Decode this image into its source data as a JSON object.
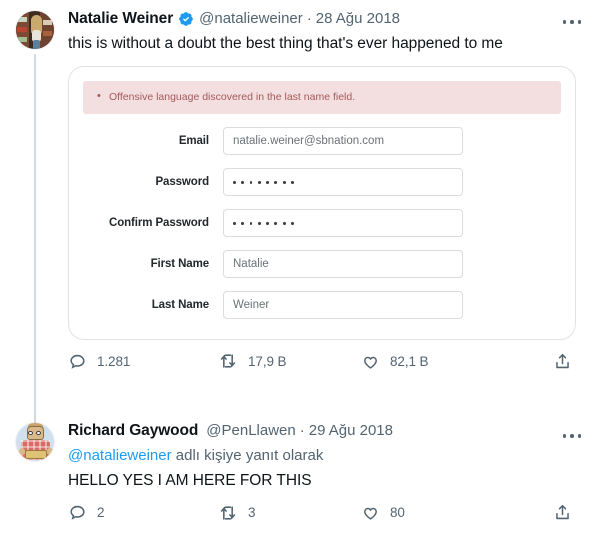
{
  "thread": {
    "tweets": [
      {
        "author_name": "Natalie Weiner",
        "verified": true,
        "handle": "@natalieweiner",
        "separator": "·",
        "date": "28 Ağu 2018",
        "text": "this is without a doubt the best thing that's ever happened to me",
        "avatar_kind": "photo-avatar",
        "more_label": "More",
        "actions": {
          "reply_count": "1.281",
          "retweet_count": "17,9 B",
          "like_count": "82,1 B",
          "share_label": ""
        }
      },
      {
        "author_name": "Richard Gaywood",
        "verified": false,
        "handle": "@PenLlawen",
        "separator": "·",
        "date": "29 Ağu 2018",
        "reply_context_mention": "@natalieweiner",
        "reply_context_suffix": " adlı kişiye yanıt olarak",
        "text": "HELLO YES I AM HERE FOR THIS",
        "avatar_kind": "cartoon-avatar",
        "more_label": "More",
        "actions": {
          "reply_count": "2",
          "retweet_count": "3",
          "like_count": "80",
          "share_label": ""
        }
      }
    ]
  },
  "embedded_form": {
    "alert": {
      "message": "Offensive language discovered in the last name field.",
      "bg_color": "#f3dfdf",
      "text_color": "#a4595b"
    },
    "fields": [
      {
        "label": "Email",
        "value": "natalie.weiner@sbnation.com",
        "type": "text"
      },
      {
        "label": "Password",
        "value": "",
        "type": "password",
        "dot_count": 8
      },
      {
        "label": "Confirm Password",
        "value": "",
        "type": "password",
        "dot_count": 8
      },
      {
        "label": "First Name",
        "value": "Natalie",
        "type": "text"
      },
      {
        "label": "Last Name",
        "value": "Weiner",
        "type": "text"
      }
    ]
  },
  "colors": {
    "link": "#1d9bf0",
    "verified_badge": "#1d9bf0",
    "meta_text": "#536471",
    "primary_text": "#0f1419",
    "thread_line": "#cfd9de",
    "card_border": "#dfe3e6"
  }
}
